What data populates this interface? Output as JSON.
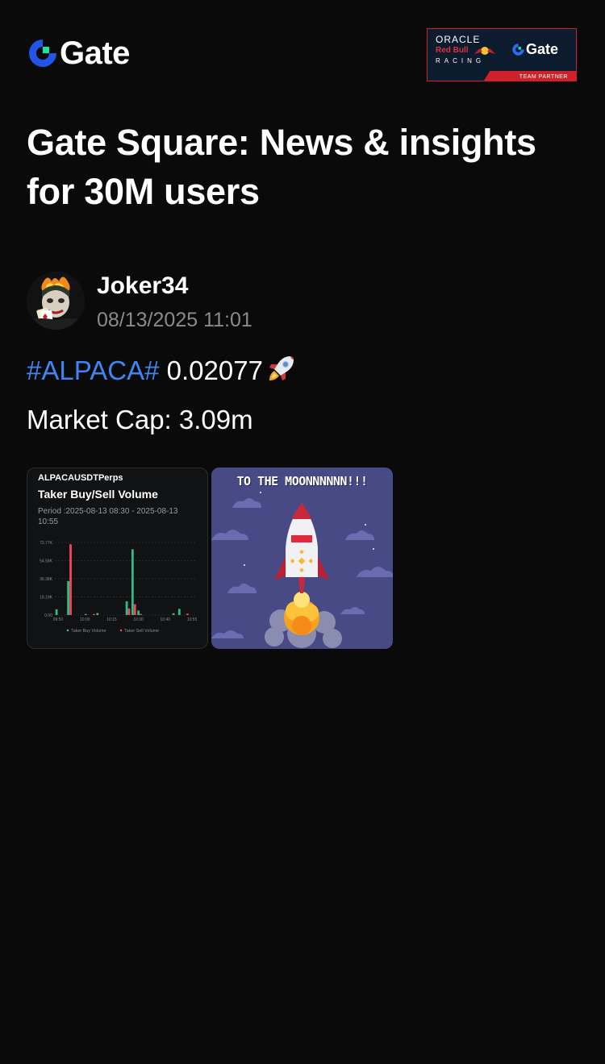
{
  "header": {
    "logo_text": "Gate",
    "logo_icon": "gate-logo-icon",
    "partner_badge": {
      "oracle": "ORACLE",
      "redbull": "Red Bull",
      "racing": "RACING",
      "gate": "Gate",
      "strip": "TEAM PARTNER"
    }
  },
  "headline": "Gate Square: News & insights for 30M users",
  "post": {
    "author": "Joker34",
    "date": "08/13/2025 11:01",
    "hashtag": "#ALPACA#",
    "price": "0.02077",
    "emoji": "rocket-icon",
    "market_cap": "Market Cap: 3.09m",
    "images": [
      {
        "kind": "chart",
        "pair": "ALPACAUSDTPerps",
        "title": "Taker Buy/Sell Volume",
        "period": "Period :2025-08-13 08:30 - 2025-08-13 10:55"
      },
      {
        "kind": "meme",
        "caption": "TO THE MOONNNNNN!!!"
      }
    ]
  },
  "colors": {
    "background": "#0a0a0a",
    "hashtag": "#3f86f2",
    "date": "#8a8a8a",
    "buy": "#2ebd85",
    "sell": "#f6465d"
  },
  "chart_data": {
    "type": "bar",
    "title": "Taker Buy/Sell Volume",
    "yticks": [
      "72.77K",
      "54.58K",
      "36.38K",
      "18.19K",
      "0.00"
    ],
    "xticks": [
      "09:50",
      "10:00",
      "10:15",
      "10:30",
      "10:40",
      "10:55"
    ],
    "ylim": [
      0,
      72770
    ],
    "series": [
      {
        "name": "Taker Buy Volume",
        "color": "#2ebd85",
        "values": [
          5800,
          0,
          34000,
          0,
          0,
          1000,
          0,
          2000,
          0,
          0,
          0,
          0,
          13800,
          66000,
          4500,
          0,
          0,
          0,
          0,
          0,
          1800,
          6200,
          0,
          0
        ]
      },
      {
        "name": "Taker Sell Volume",
        "color": "#f6465d",
        "values": [
          0,
          0,
          71000,
          0,
          0,
          0,
          1000,
          0,
          0,
          0,
          0,
          0,
          6600,
          10800,
          1100,
          0,
          0,
          0,
          0,
          0,
          0,
          0,
          1400,
          0
        ]
      }
    ],
    "legend": "bottom-center"
  }
}
